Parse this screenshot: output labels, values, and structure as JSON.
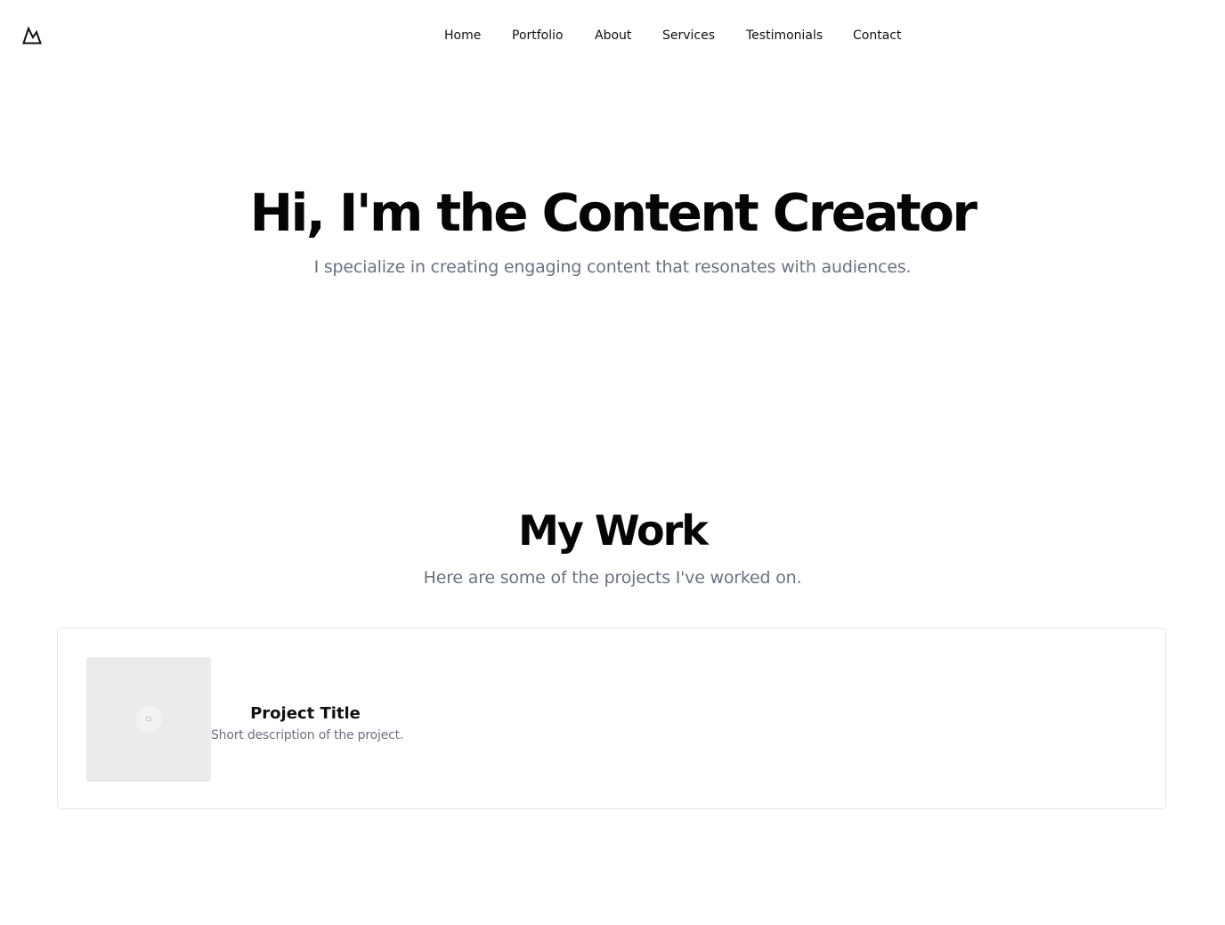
{
  "header": {
    "logo_icon": "mountain-logo-icon",
    "nav": [
      {
        "label": "Home"
      },
      {
        "label": "Portfolio"
      },
      {
        "label": "About"
      },
      {
        "label": "Services"
      },
      {
        "label": "Testimonials"
      },
      {
        "label": "Contact"
      }
    ]
  },
  "hero": {
    "title": "Hi, I'm the Content Creator",
    "subtitle": "I specialize in creating engaging content that resonates with audiences."
  },
  "work": {
    "title": "My Work",
    "subtitle": "Here are some of the projects I've worked on.",
    "projects": [
      {
        "image_icon": "image-placeholder-icon",
        "title": "Project Title",
        "description": "Short description of the project."
      }
    ]
  },
  "colors": {
    "text": "#111111",
    "muted": "#6b7280",
    "border": "#e5e7eb",
    "placeholder": "#ebebeb"
  }
}
